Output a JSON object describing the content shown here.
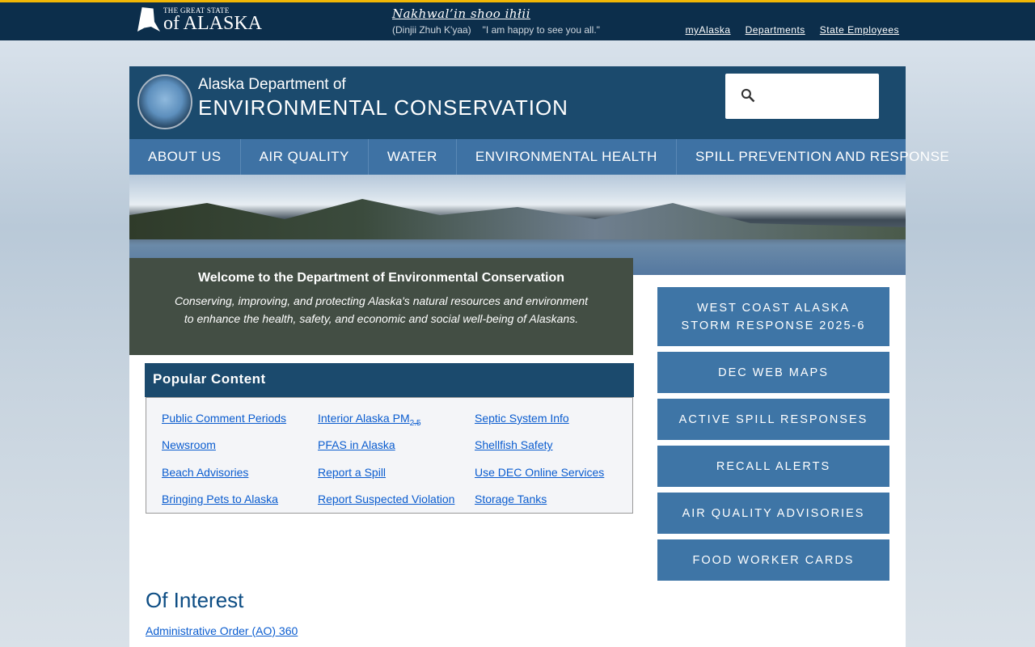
{
  "topbar": {
    "logo_line1": "THE GREAT STATE",
    "logo_line2": "of ALASKA",
    "native_phrase": "Nakhwal’in shoo ihłii",
    "native_language": "(Dinjii Zhuh K'yaa)",
    "native_translation": "\"I am happy to see you all.\"",
    "links": [
      "myAlaska",
      "Departments",
      "State Employees"
    ]
  },
  "header": {
    "agency_line1": "Alaska Department of",
    "agency_line2": "ENVIRONMENTAL CONSERVATION",
    "search_placeholder": ""
  },
  "nav": [
    "ABOUT US",
    "AIR QUALITY",
    "WATER",
    "ENVIRONMENTAL HEALTH",
    "SPILL PREVENTION AND RESPONSE"
  ],
  "welcome": {
    "title": "Welcome to the Department of Environmental Conservation",
    "text": "Conserving, improving, and protecting Alaska's natural resources and environment to enhance the health, safety, and economic and social well-being of Alaskans."
  },
  "popular": {
    "title": "Popular Content",
    "links": [
      "Public Comment Periods",
      "Interior Alaska PM",
      "Septic System Info",
      "Newsroom",
      "PFAS in Alaska",
      "Shellfish Safety",
      "Beach Advisories",
      "Report a Spill",
      "Use DEC Online Services",
      "Bringing Pets to Alaska",
      "Report Suspected Violation",
      "Storage Tanks"
    ],
    "pm_subscript": "2.5"
  },
  "side_buttons": [
    "WEST COAST ALASKA STORM RESPONSE 2025-6",
    "DEC WEB MAPS",
    "ACTIVE SPILL RESPONSES",
    "RECALL ALERTS",
    "AIR QUALITY ADVISORIES",
    "FOOD WORKER CARDS"
  ],
  "interest": {
    "title": "Of Interest",
    "links": [
      "Administrative Order (AO) 360"
    ]
  }
}
